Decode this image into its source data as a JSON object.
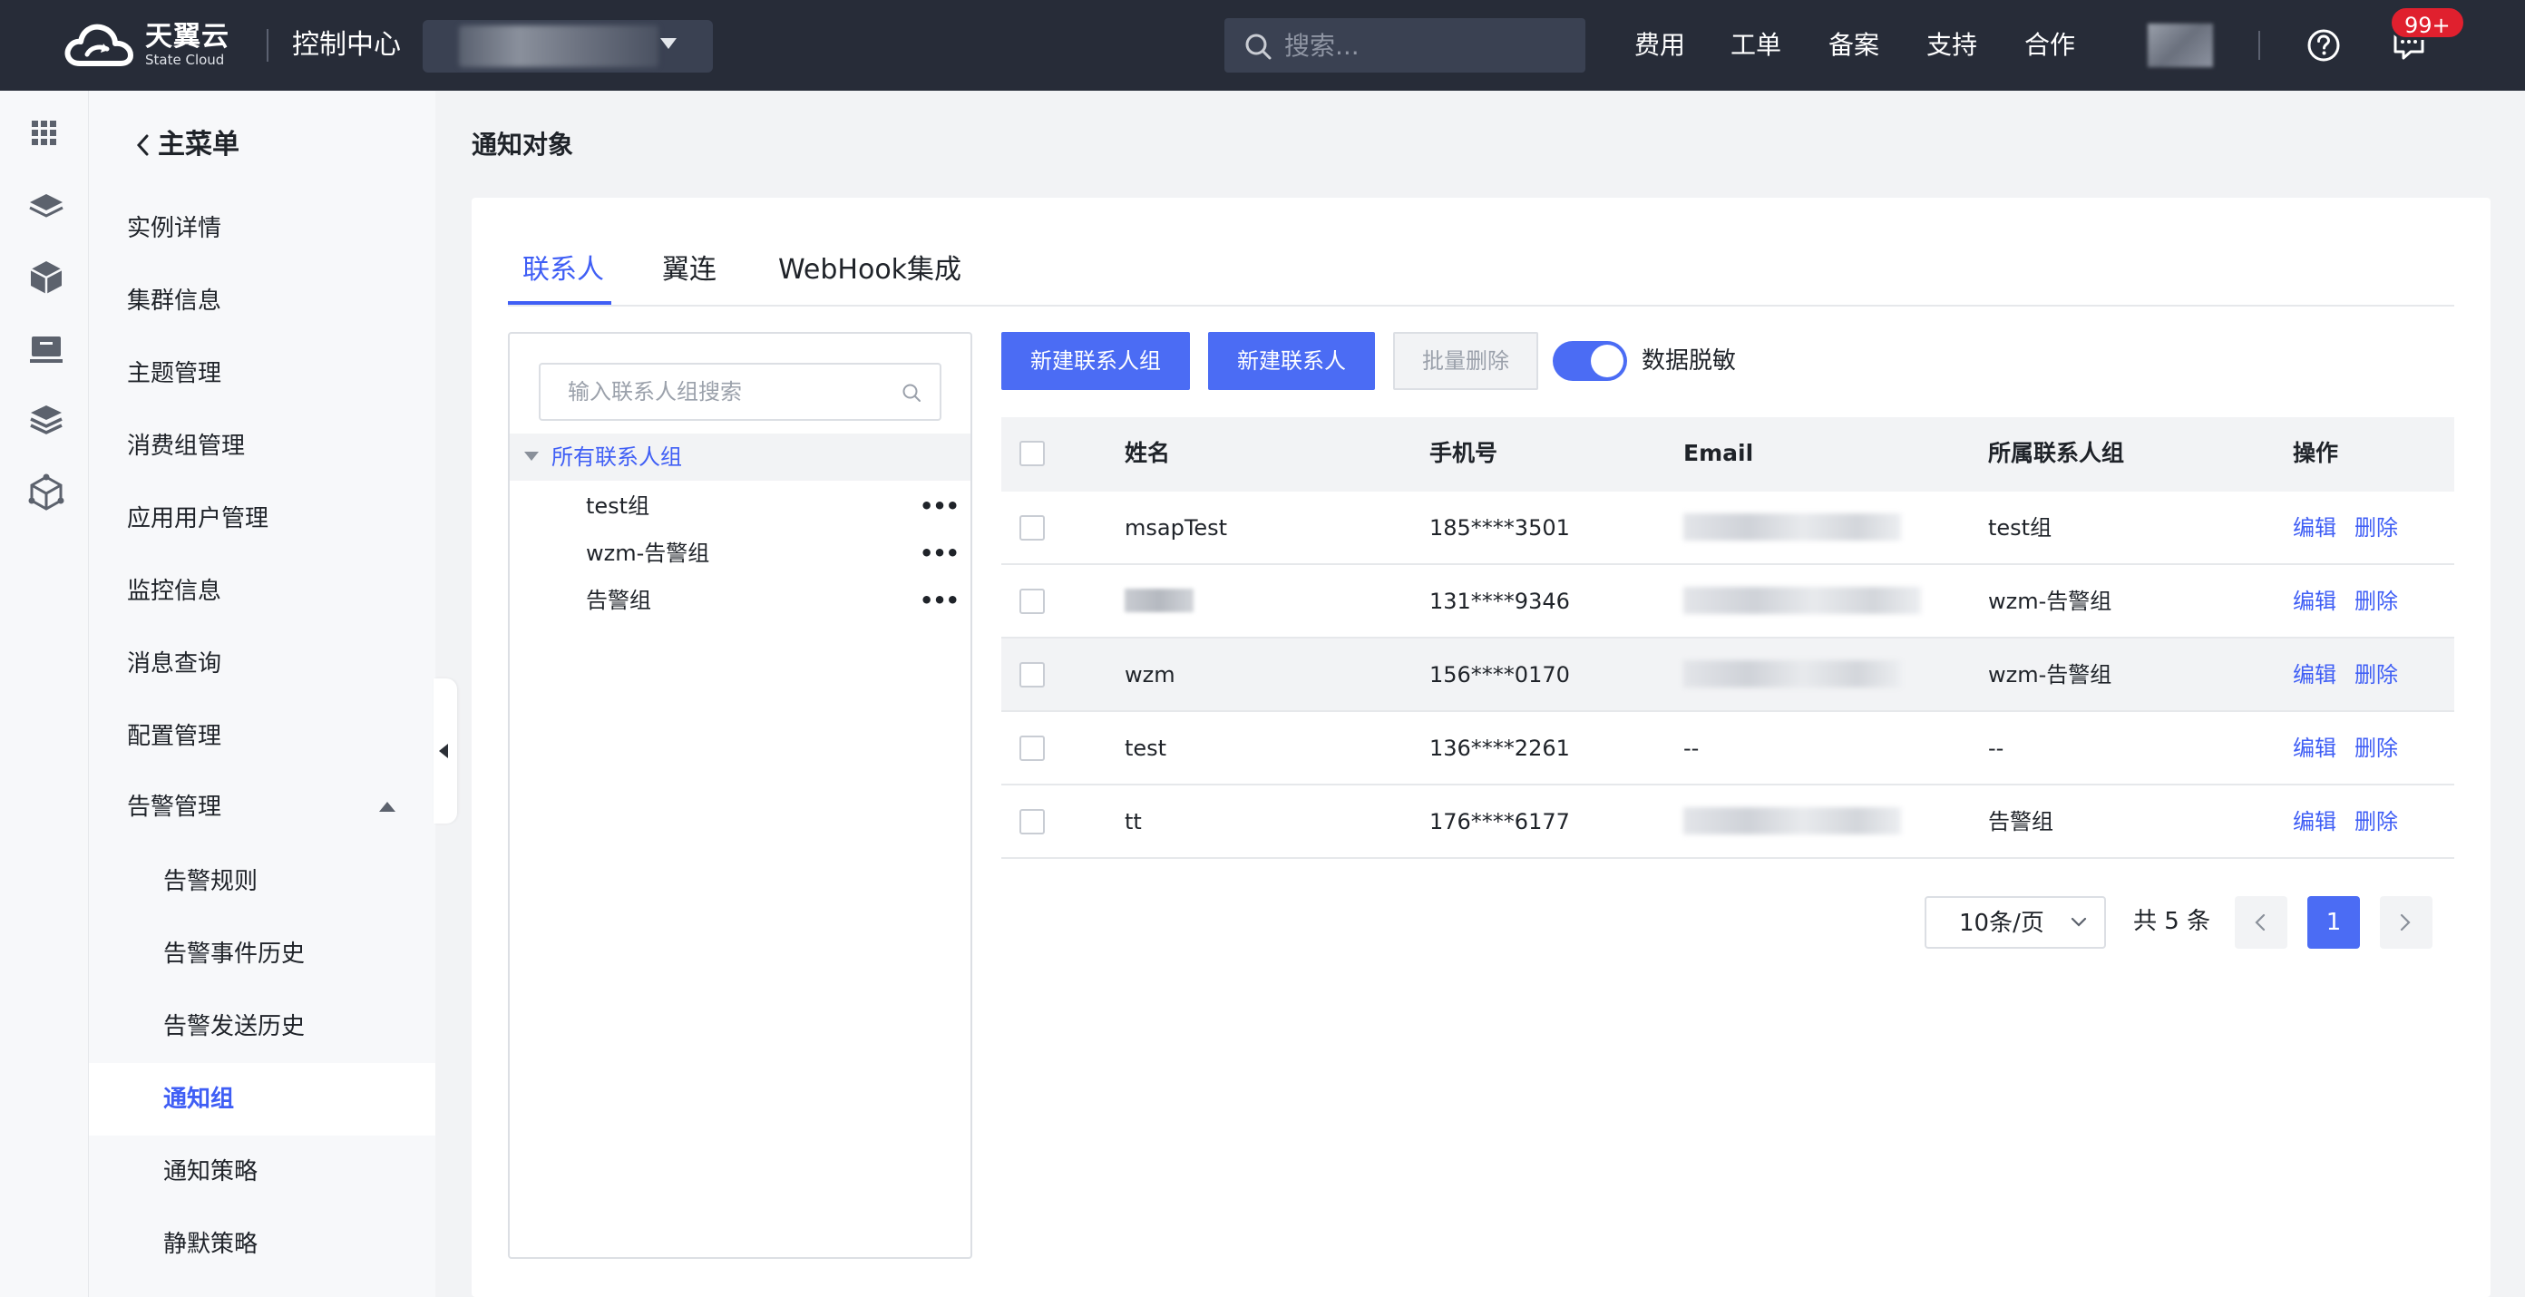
{
  "topbar": {
    "logo_cn": "天翼云",
    "logo_en": "State Cloud",
    "console_title": "控制中心",
    "search_placeholder": "搜索...",
    "nav": [
      "费用",
      "工单",
      "备案",
      "支持",
      "合作"
    ],
    "badge": "99+"
  },
  "sidemenu": {
    "back_label": "主菜单",
    "items": [
      "实例详情",
      "集群信息",
      "主题管理",
      "消费组管理",
      "应用用户管理",
      "监控信息",
      "消息查询",
      "配置管理",
      "告警管理"
    ],
    "sub_items": [
      "告警规则",
      "告警事件历史",
      "告警发送历史",
      "通知组",
      "通知策略",
      "静默策略"
    ],
    "active_sub": "通知组"
  },
  "page": {
    "title": "通知对象",
    "tabs": [
      "联系人",
      "翼连",
      "WebHook集成"
    ]
  },
  "groups": {
    "search_placeholder": "输入联系人组搜索",
    "root": "所有联系人组",
    "nodes": [
      "test组",
      "wzm-告警组",
      "告警组"
    ],
    "more": "•••"
  },
  "toolbar": {
    "new_group": "新建联系人组",
    "new_contact": "新建联系人",
    "batch_delete": "批量删除",
    "mask_label": "数据脱敏",
    "mask_on": true
  },
  "table": {
    "headers": [
      "姓名",
      "手机号",
      "Email",
      "所属联系人组",
      "操作"
    ],
    "rows": [
      {
        "name": "msapTest",
        "phone": "185****3501",
        "email": "",
        "group": "test组"
      },
      {
        "name": "",
        "phone": "131****9346",
        "email": "",
        "group": "wzm-告警组"
      },
      {
        "name": "wzm",
        "phone": "156****0170",
        "email": "",
        "group": "wzm-告警组"
      },
      {
        "name": "test",
        "phone": "136****2261",
        "email": "--",
        "group": "--"
      },
      {
        "name": "tt",
        "phone": "176****6177",
        "email": "",
        "group": "告警组"
      }
    ],
    "edit": "编辑",
    "delete": "删除"
  },
  "pager": {
    "page_size": "10条/页",
    "total": "共 5 条",
    "current": "1"
  },
  "colors": {
    "primary": "#4b6cf4",
    "link": "#3f5ef5",
    "topbar": "#272c38",
    "badge": "#e0202e"
  }
}
